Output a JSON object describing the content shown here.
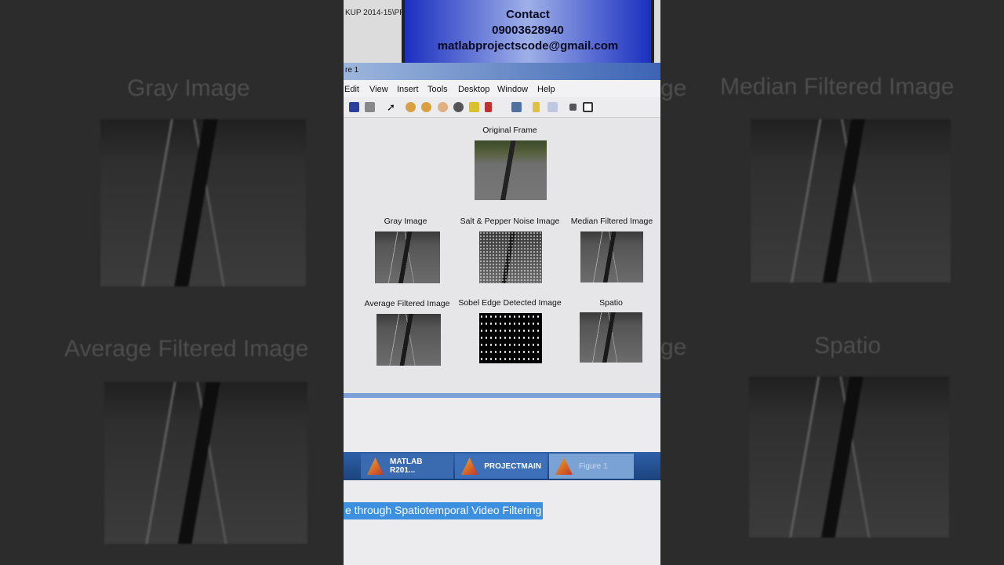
{
  "background": {
    "left_labels": [
      "Gray Image",
      "Average Filtered Image"
    ],
    "right_labels": [
      "Median Filtered Image",
      "Spatio"
    ],
    "fragments": [
      "ge",
      "ge"
    ]
  },
  "overlay": {
    "line1": "Contact",
    "phone": "09003628940",
    "email": "matlabprojectscode@gmail.com",
    "path": "KUP 2014-15\\PR"
  },
  "window": {
    "title": "re 1",
    "menu": [
      "Edit",
      "View",
      "Insert",
      "Tools",
      "Desktop",
      "Window",
      "Help"
    ]
  },
  "figure": {
    "original": "Original Frame",
    "row1": [
      "Gray Image",
      "Salt & Pepper Noise Image",
      "Median Filtered Image"
    ],
    "row2": [
      "Average Filtered Image",
      "Sobel Edge Detected Image",
      "Spatio"
    ]
  },
  "taskbar": [
    "MATLAB R201...",
    "PROJECTMAIN",
    "Figure 1"
  ],
  "selected_text": "e through Spatiotemporal Video Filtering"
}
